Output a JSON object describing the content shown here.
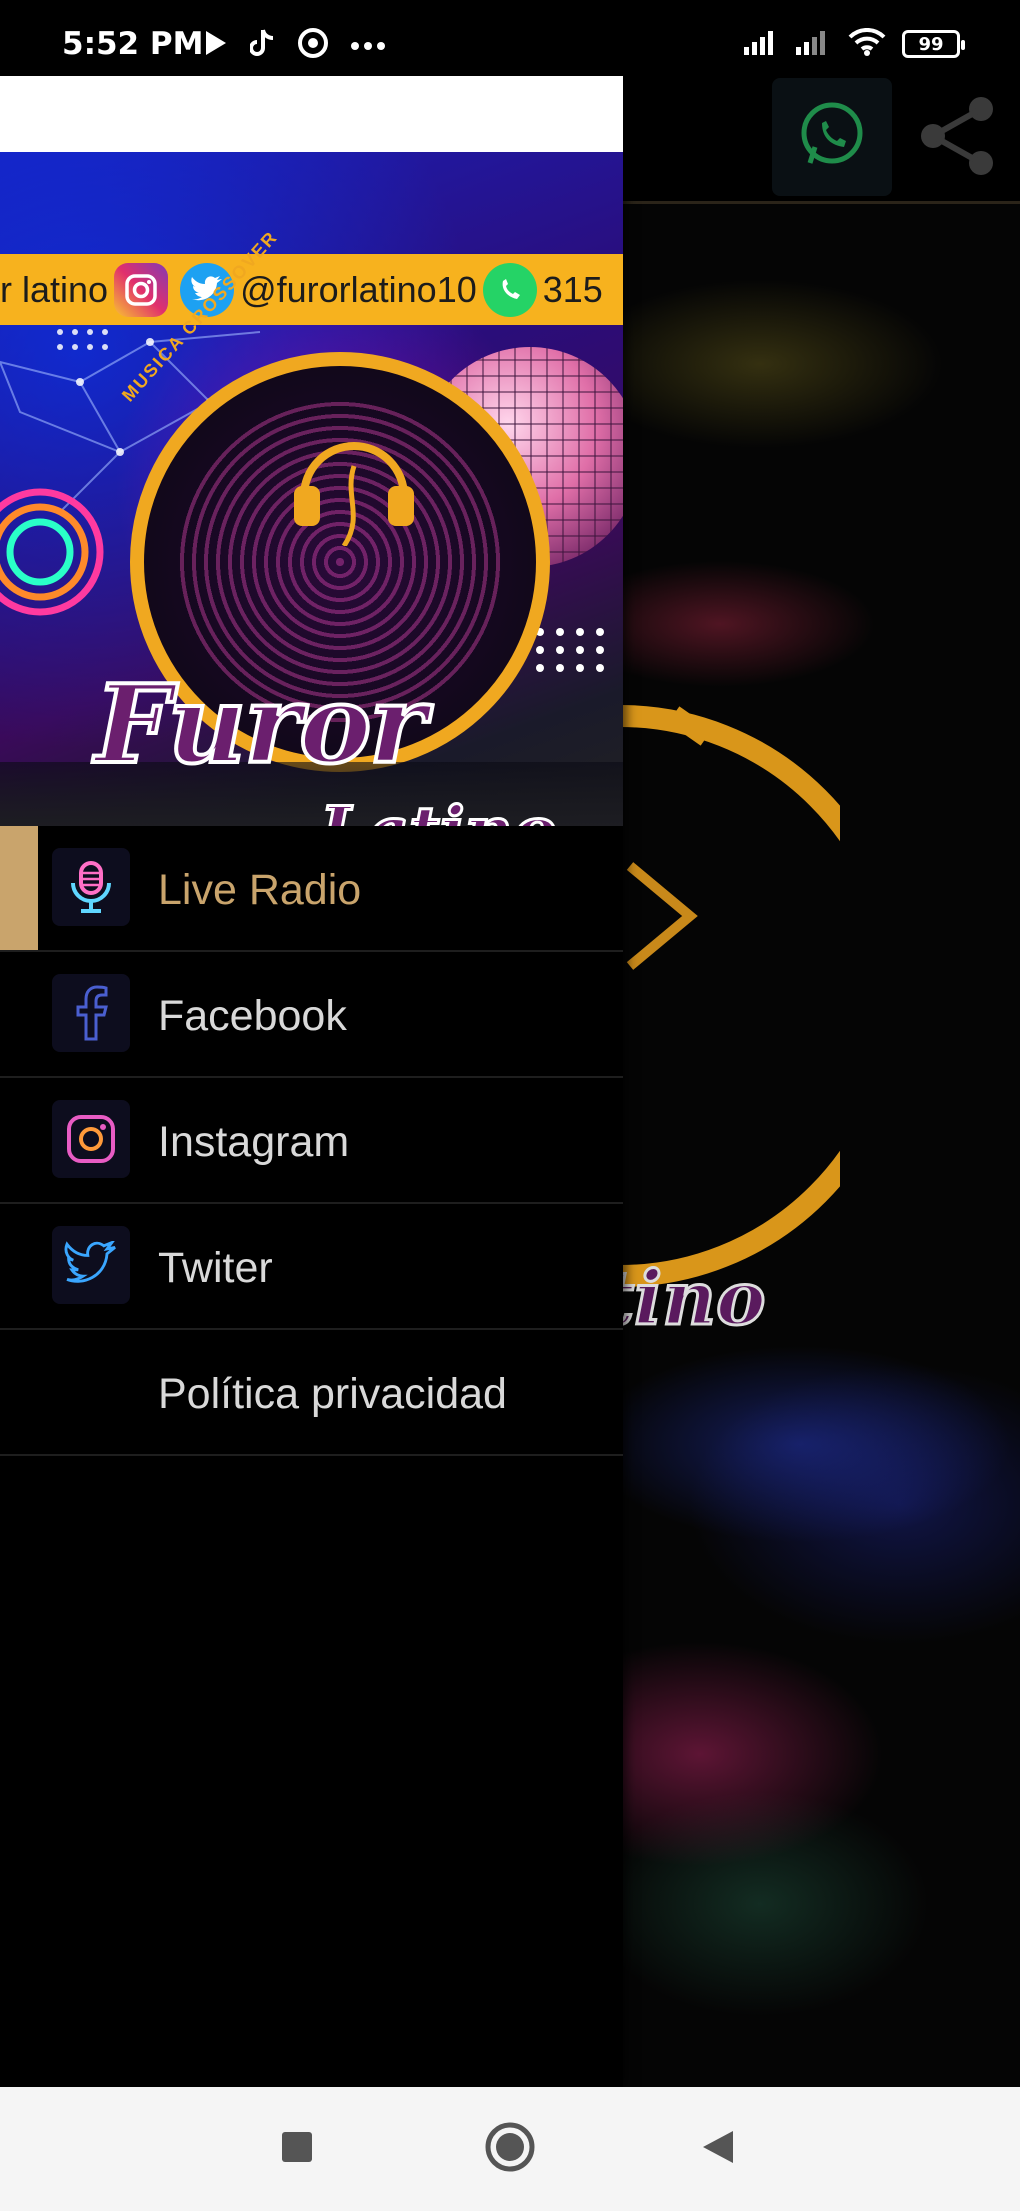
{
  "status_bar": {
    "time": "5:52 PM",
    "battery": "99",
    "icons": [
      "play-icon",
      "tiktok-icon",
      "chrome-icon",
      "more-dots-icon",
      "signal-icon",
      "signal-icon",
      "wifi-icon",
      "battery-icon"
    ]
  },
  "header": {
    "banner_handle_prefix": "r latino",
    "banner_handle": "@furorlatino10",
    "banner_phone_partial": "315",
    "logo_arc": "MUSICA CROSSOVER",
    "logo_word1": "Furor",
    "logo_word2": "Latino"
  },
  "menu": {
    "items": [
      {
        "label": "Live Radio",
        "icon": "microphone-icon",
        "active": true
      },
      {
        "label": "Facebook",
        "icon": "facebook-icon",
        "active": false
      },
      {
        "label": "Instagram",
        "icon": "instagram-icon",
        "active": false
      },
      {
        "label": "Twiter",
        "icon": "twitter-icon",
        "active": false
      },
      {
        "label": "Política privacidad",
        "icon": "",
        "active": false
      }
    ]
  },
  "background_app": {
    "actions": [
      "whatsapp-icon",
      "share-icon"
    ],
    "logo_fragment": "tino"
  },
  "colors": {
    "accent": "#c9a46c",
    "banner": "#f7b21e",
    "logo_gold": "#f0a820",
    "logo_purple": "#6b1f6e",
    "drawer_bg": "#000000",
    "nav_bg": "#f5f5f5"
  }
}
